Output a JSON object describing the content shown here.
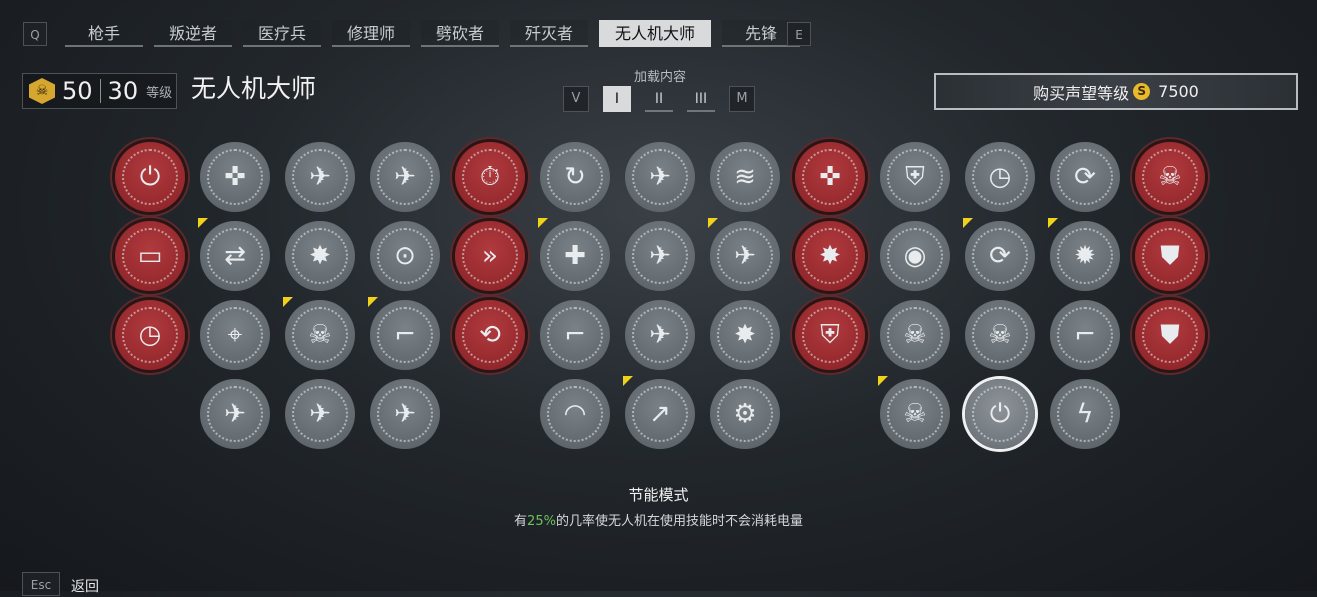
{
  "nav": {
    "prev_key": "Q",
    "next_key": "E",
    "tabs": [
      "枪手",
      "叛逆者",
      "医疗兵",
      "修理师",
      "劈砍者",
      "歼灭者",
      "无人机大师",
      "先锋"
    ],
    "active_tab": 6
  },
  "header": {
    "level_icon": "skull-badge-icon",
    "level_a": "50",
    "level_b": "30",
    "level_label": "等级",
    "class_title": "无人机大师"
  },
  "loadout": {
    "label": "加载内容",
    "prev_key": "V",
    "next_key": "M",
    "slots": [
      "I",
      "II",
      "III"
    ],
    "active_slot": 0
  },
  "buy": {
    "label": "购买声望等级",
    "coin_glyph": "S",
    "price": "7500"
  },
  "tree": {
    "flag_color": "#f1d21b",
    "red_color": "#94282c",
    "grey_color": "#61686d",
    "nodes": [
      {
        "r": 0,
        "c": 0,
        "t": "red",
        "icon": "power-button-icon",
        "glyph": "⏻"
      },
      {
        "r": 0,
        "c": 1,
        "t": "grey",
        "icon": "drone-target-icon",
        "glyph": "✜"
      },
      {
        "r": 0,
        "c": 2,
        "t": "grey",
        "icon": "drone-ammo-icon",
        "glyph": "✈"
      },
      {
        "r": 0,
        "c": 3,
        "t": "grey",
        "icon": "drone-rank-icon",
        "glyph": "✈"
      },
      {
        "r": 0,
        "c": 4,
        "t": "red",
        "icon": "timer-battery-icon",
        "glyph": "⏱"
      },
      {
        "r": 0,
        "c": 5,
        "t": "grey",
        "icon": "battery-cycle-icon",
        "glyph": "↻"
      },
      {
        "r": 0,
        "c": 6,
        "t": "grey",
        "icon": "drone-cooldown-icon",
        "glyph": "✈"
      },
      {
        "r": 0,
        "c": 7,
        "t": "grey",
        "icon": "drone-wave-icon",
        "glyph": "≋"
      },
      {
        "r": 0,
        "c": 8,
        "t": "red",
        "icon": "drone-overdrive-icon",
        "glyph": "✜"
      },
      {
        "r": 0,
        "c": 9,
        "t": "grey",
        "icon": "turret-check-icon",
        "glyph": "⛨"
      },
      {
        "r": 0,
        "c": 10,
        "t": "grey",
        "icon": "backpack-timer-icon",
        "glyph": "◷"
      },
      {
        "r": 0,
        "c": 11,
        "t": "grey",
        "icon": "drone-cycle-icon",
        "glyph": "⟳"
      },
      {
        "r": 0,
        "c": 12,
        "t": "red",
        "icon": "skull-stack-icon",
        "glyph": "☠"
      },
      {
        "r": 1,
        "c": 0,
        "t": "red",
        "icon": "battery-ammo-icon",
        "glyph": "▭"
      },
      {
        "r": 1,
        "c": 1,
        "t": "grey",
        "icon": "battery-swap-icon",
        "glyph": "⇄",
        "flag": true
      },
      {
        "r": 1,
        "c": 2,
        "t": "grey",
        "icon": "drone-explosion-icon",
        "glyph": "✸"
      },
      {
        "r": 1,
        "c": 3,
        "t": "grey",
        "icon": "drone-deploy-icon",
        "glyph": "⊙"
      },
      {
        "r": 1,
        "c": 4,
        "t": "red",
        "icon": "chevrons-icon",
        "glyph": "»"
      },
      {
        "r": 1,
        "c": 5,
        "t": "grey",
        "icon": "medical-cross-icon",
        "glyph": "✚",
        "flag": true
      },
      {
        "r": 1,
        "c": 6,
        "t": "grey",
        "icon": "drone-heal-icon",
        "glyph": "✈"
      },
      {
        "r": 1,
        "c": 7,
        "t": "grey",
        "icon": "drone-soldier-icon",
        "glyph": "✈",
        "flag": true
      },
      {
        "r": 1,
        "c": 8,
        "t": "red",
        "icon": "drone-blast-icon",
        "glyph": "✸"
      },
      {
        "r": 1,
        "c": 9,
        "t": "grey",
        "icon": "speaker-target-icon",
        "glyph": "◉"
      },
      {
        "r": 1,
        "c": 10,
        "t": "grey",
        "icon": "drone-refresh-icon",
        "glyph": "⟳",
        "flag": true
      },
      {
        "r": 1,
        "c": 11,
        "t": "grey",
        "icon": "ammo-explosion-icon",
        "glyph": "✹",
        "flag": true
      },
      {
        "r": 1,
        "c": 12,
        "t": "red",
        "icon": "drone-shield-icon",
        "glyph": "⛊"
      },
      {
        "r": 2,
        "c": 0,
        "t": "red",
        "icon": "drone-timer-icon",
        "glyph": "◷"
      },
      {
        "r": 2,
        "c": 1,
        "t": "grey",
        "icon": "crosshair-drone-icon",
        "glyph": "⌖"
      },
      {
        "r": 2,
        "c": 2,
        "t": "grey",
        "icon": "skull-lightning-icon",
        "glyph": "☠",
        "flag": true
      },
      {
        "r": 2,
        "c": 3,
        "t": "grey",
        "icon": "rifle-platform-icon",
        "glyph": "⌐",
        "flag": true
      },
      {
        "r": 2,
        "c": 4,
        "t": "red",
        "icon": "turret-cycle-icon",
        "glyph": "⟲"
      },
      {
        "r": 2,
        "c": 5,
        "t": "grey",
        "icon": "shotgun-platform-icon",
        "glyph": "⌐"
      },
      {
        "r": 2,
        "c": 6,
        "t": "grey",
        "icon": "drone-runner-icon",
        "glyph": "✈"
      },
      {
        "r": 2,
        "c": 7,
        "t": "grey",
        "icon": "drone-burst-icon",
        "glyph": "✸"
      },
      {
        "r": 2,
        "c": 8,
        "t": "red",
        "icon": "turret-drones-icon",
        "glyph": "⛨"
      },
      {
        "r": 2,
        "c": 9,
        "t": "grey",
        "icon": "skull-badge-icon",
        "glyph": "☠"
      },
      {
        "r": 2,
        "c": 10,
        "t": "grey",
        "icon": "skull-crosshair-icon",
        "glyph": "☠"
      },
      {
        "r": 2,
        "c": 11,
        "t": "grey",
        "icon": "pistol-platform-icon",
        "glyph": "⌐"
      },
      {
        "r": 2,
        "c": 12,
        "t": "red",
        "icon": "skull-shield-icon",
        "glyph": "⛊"
      },
      {
        "r": 3,
        "c": 1,
        "t": "grey",
        "icon": "drone-gun-icon",
        "glyph": "✈"
      },
      {
        "r": 3,
        "c": 2,
        "t": "grey",
        "icon": "drone-grenade-icon",
        "glyph": "✈"
      },
      {
        "r": 3,
        "c": 3,
        "t": "grey",
        "icon": "drone-gun-heal-icon",
        "glyph": "✈"
      },
      {
        "r": 3,
        "c": 5,
        "t": "grey",
        "icon": "signal-battery-icon",
        "glyph": "◠"
      },
      {
        "r": 3,
        "c": 6,
        "t": "grey",
        "icon": "drone-boost-icon",
        "glyph": "↗",
        "flag": true
      },
      {
        "r": 3,
        "c": 7,
        "t": "grey",
        "icon": "robot-upgrade-icon",
        "glyph": "⚙"
      },
      {
        "r": 3,
        "c": 9,
        "t": "grey",
        "icon": "skull-blast-icon",
        "glyph": "☠",
        "flag": true
      },
      {
        "r": 3,
        "c": 10,
        "t": "selected",
        "icon": "power-saving-drone-icon",
        "glyph": "⏻"
      },
      {
        "r": 3,
        "c": 11,
        "t": "grey",
        "icon": "drone-lightning-icon",
        "glyph": "ϟ"
      }
    ]
  },
  "description": {
    "title": "节能模式",
    "text_before": "有",
    "highlight": "25%",
    "text_after": "的几率使无人机在使用技能时不会消耗电量"
  },
  "footer": {
    "esc_key": "Esc",
    "back_label": "返回"
  }
}
